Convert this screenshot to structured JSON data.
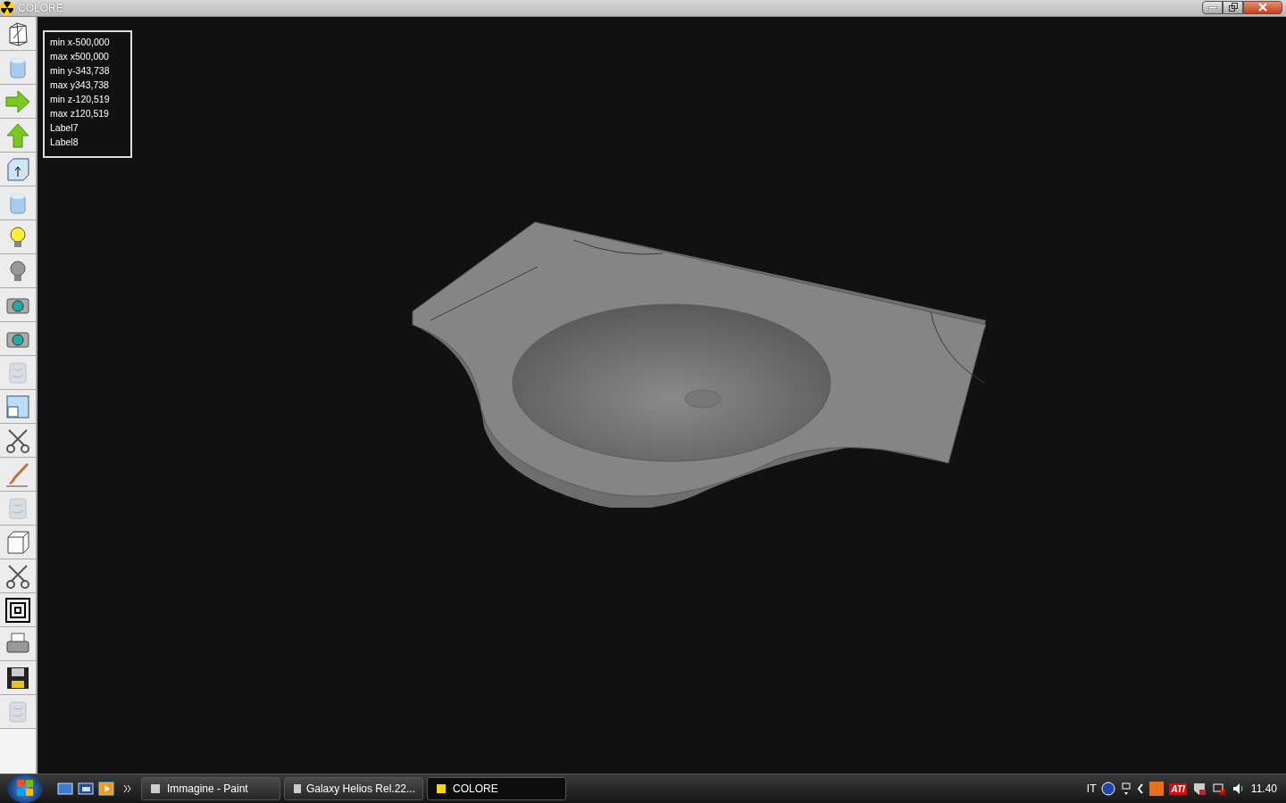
{
  "window": {
    "title": "COLORE"
  },
  "toolbar": [
    {
      "kind": "wireframe",
      "disabled": false
    },
    {
      "kind": "cylinder",
      "disabled": false
    },
    {
      "kind": "arrow-right",
      "disabled": false
    },
    {
      "kind": "arrow-up",
      "disabled": false
    },
    {
      "kind": "box-arrow",
      "disabled": false
    },
    {
      "kind": "cylinder",
      "disabled": false
    },
    {
      "kind": "bulb-on",
      "disabled": false
    },
    {
      "kind": "bulb-off",
      "disabled": false
    },
    {
      "kind": "camera",
      "disabled": false
    },
    {
      "kind": "camera",
      "disabled": false
    },
    {
      "kind": "blank",
      "disabled": true
    },
    {
      "kind": "window",
      "disabled": false
    },
    {
      "kind": "scissors",
      "disabled": false
    },
    {
      "kind": "brush",
      "disabled": false
    },
    {
      "kind": "blank",
      "disabled": true
    },
    {
      "kind": "cube",
      "disabled": false
    },
    {
      "kind": "scissors",
      "disabled": false
    },
    {
      "kind": "squares",
      "disabled": false
    },
    {
      "kind": "printer",
      "disabled": false
    },
    {
      "kind": "floppy",
      "disabled": false
    },
    {
      "kind": "blank",
      "disabled": true
    }
  ],
  "info_labels": [
    "min x-500,000",
    "max x500,000",
    "min y-343,738",
    "max y343,738",
    "min z-120,519",
    "max z120,519",
    "Label7",
    "Label8"
  ],
  "taskbar": {
    "tasks": [
      {
        "label": "Immagine - Paint",
        "selected": false
      },
      {
        "label": "Galaxy Helios  Rel.22...",
        "selected": false
      },
      {
        "label": "COLORE",
        "selected": true
      }
    ],
    "language": "IT",
    "tray_badge": "ATI",
    "clock": "11.40"
  }
}
